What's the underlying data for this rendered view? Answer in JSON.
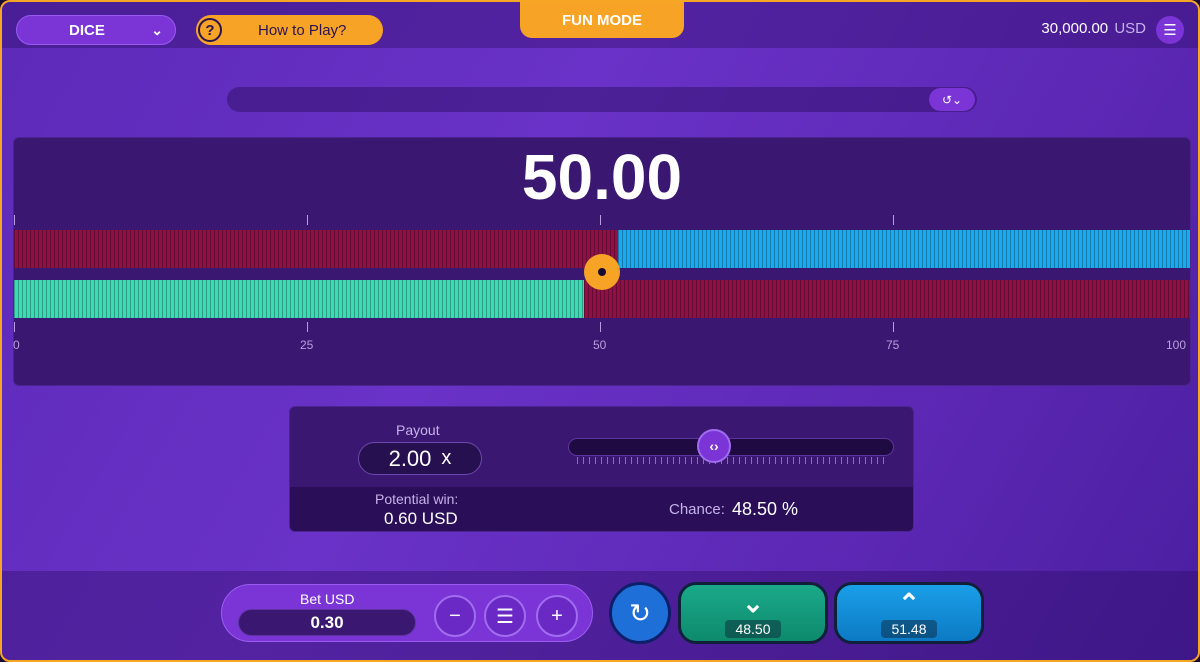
{
  "header": {
    "game_selector": "DICE",
    "how_to_play": "How to Play?",
    "mode": "FUN MODE",
    "balance": "30,000.00",
    "currency": "USD"
  },
  "roll": {
    "value": "50.00",
    "scale_labels": [
      "0",
      "25",
      "50",
      "75",
      "100"
    ],
    "marker_position": 50.0
  },
  "payout_panel": {
    "payout_label": "Payout",
    "payout_value": "2.00",
    "payout_suffix": "x",
    "potential_label": "Potential win:",
    "potential_value": "0.60 USD",
    "chance_label": "Chance:",
    "chance_value": "48.50 %",
    "slider_level": 0.43
  },
  "bet": {
    "label": "Bet USD",
    "value": "0.30"
  },
  "actions": {
    "under_value": "48.50",
    "over_value": "51.48"
  },
  "colors": {
    "accent_orange": "#f7a326",
    "purple": "#7b34d6",
    "lose_red": "#8e1046",
    "over_blue": "#1aaaf0",
    "under_green": "#3ddbb5"
  },
  "icons": {
    "game_chevron": "chevron-down-icon",
    "help": "question-circle-icon",
    "menu": "hamburger-menu-icon",
    "history": "history-icon",
    "slider": "arrows-left-right-icon",
    "minus": "minus-icon",
    "coins": "coin-stack-icon",
    "plus": "plus-icon",
    "autoplay": "autoplay-icon",
    "under": "chevron-down-icon",
    "over": "chevron-up-icon"
  }
}
